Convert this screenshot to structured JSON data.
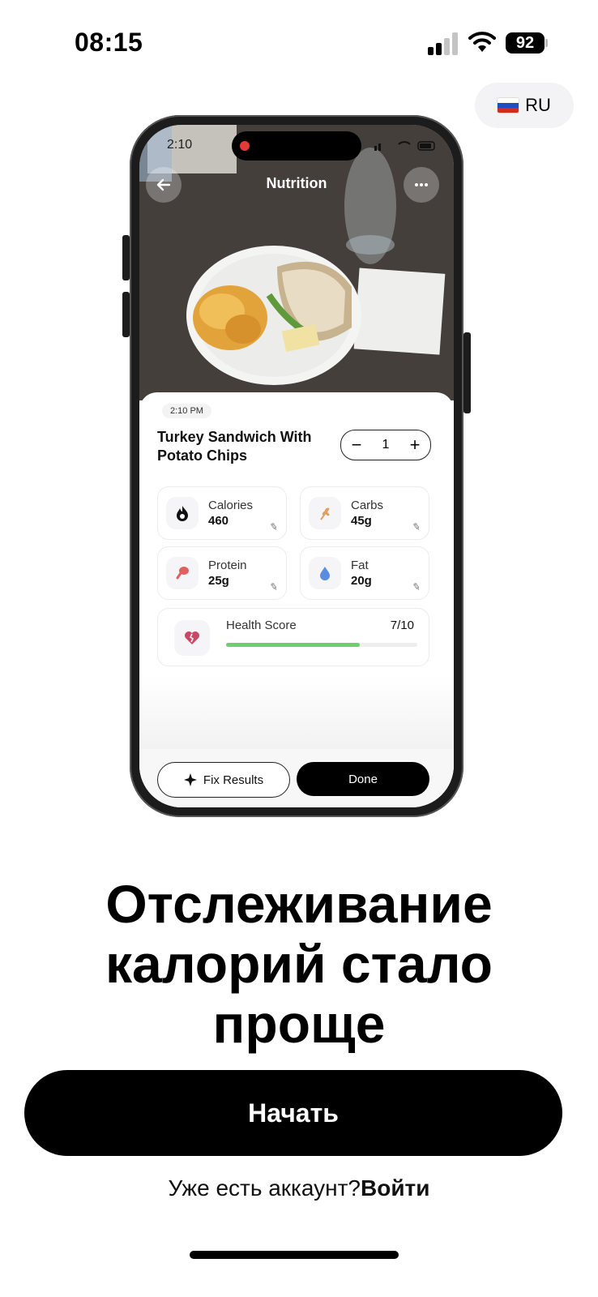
{
  "status_bar": {
    "time": "08:15",
    "battery": "92"
  },
  "language": {
    "code": "RU",
    "flag_colors": [
      "#ffffff",
      "#1e4fc2",
      "#d52b1e"
    ]
  },
  "mockup": {
    "inner_time": "2:10",
    "title": "Nutrition",
    "back_icon": "arrow-left-icon",
    "more_icon": "ellipsis-icon",
    "time_chip": "2:10 PM",
    "food_name": "Turkey Sandwich With Potato Chips",
    "quantity": {
      "minus": "−",
      "value": "1",
      "plus": "+"
    },
    "nutrients": [
      {
        "label": "Calories",
        "value": "460",
        "icon": "flame-icon",
        "color": "#111111"
      },
      {
        "label": "Carbs",
        "value": "45g",
        "icon": "wheat-icon",
        "color": "#e0a060"
      },
      {
        "label": "Protein",
        "value": "25g",
        "icon": "drumstick-icon",
        "color": "#e06060"
      },
      {
        "label": "Fat",
        "value": "20g",
        "icon": "droplet-icon",
        "color": "#5a8de0"
      }
    ],
    "health": {
      "label": "Health Score",
      "score": "7/10",
      "fraction": 0.7,
      "bar_color": "#6fcf6f"
    },
    "fix_button": "Fix Results",
    "done_button": "Done"
  },
  "headline": "Отслеживание калорий стало проще",
  "cta_label": "Начать",
  "login": {
    "prompt": "Уже есть аккаунт?",
    "link": "Войти"
  }
}
